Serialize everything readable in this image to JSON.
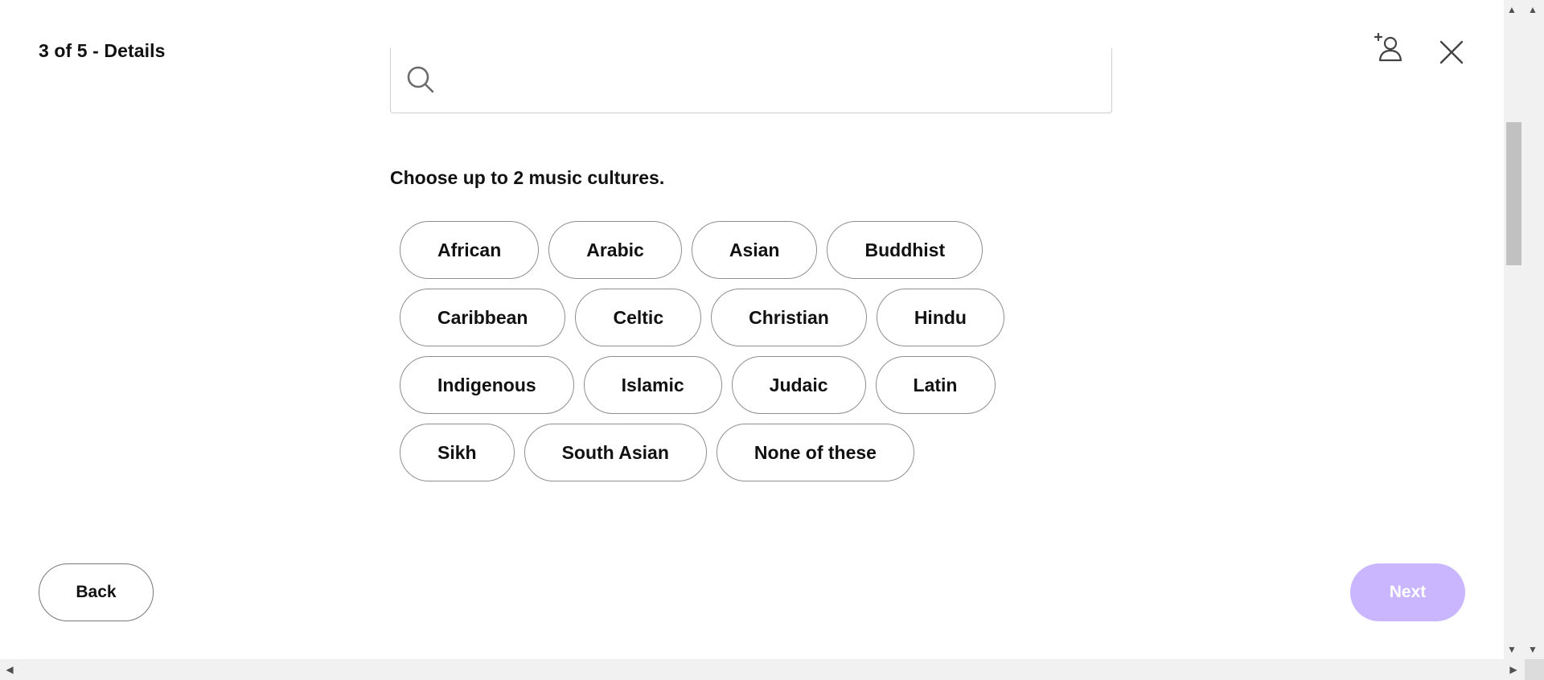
{
  "header": {
    "step_title": "3 of 5 - Details",
    "add_user_icon": "add-user-icon",
    "close_icon": "close-icon"
  },
  "search": {
    "value": "",
    "placeholder": "",
    "icon": "search-icon"
  },
  "prompt": "Choose up to 2 music cultures.",
  "chips": [
    [
      "African",
      "Arabic",
      "Asian",
      "Buddhist"
    ],
    [
      "Caribbean",
      "Celtic",
      "Christian",
      "Hindu"
    ],
    [
      "Indigenous",
      "Islamic",
      "Judaic",
      "Latin"
    ],
    [
      "Sikh",
      "South Asian",
      "None of these"
    ]
  ],
  "footer": {
    "back_label": "Back",
    "next_label": "Next"
  },
  "colors": {
    "next_disabled_bg": "#c9b6ff",
    "chip_border": "#8e8e8e",
    "text": "#111111"
  }
}
